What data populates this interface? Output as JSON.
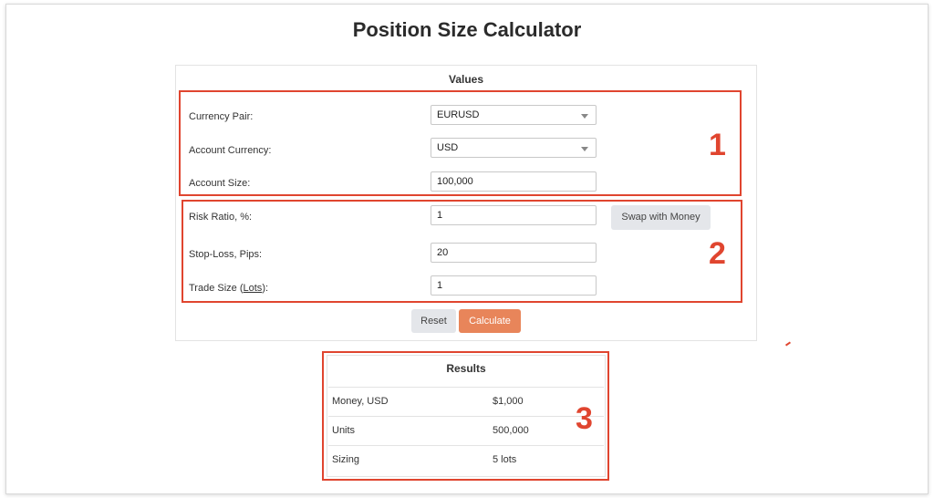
{
  "page": {
    "title": "Position Size Calculator"
  },
  "values": {
    "heading": "Values",
    "currency_pair": {
      "label": "Currency Pair:",
      "value": "EURUSD"
    },
    "account_currency": {
      "label": "Account Currency:",
      "value": "USD"
    },
    "account_size": {
      "label": "Account Size:",
      "value": "100,000"
    },
    "risk_ratio": {
      "label": "Risk Ratio, %:",
      "value": "1"
    },
    "stop_loss": {
      "label": "Stop-Loss, Pips:",
      "value": "20"
    },
    "trade_size": {
      "label_prefix": "Trade Size (",
      "label_link": "Lots",
      "label_suffix": "):",
      "value": "1"
    },
    "swap_button": "Swap with Money",
    "reset_button": "Reset",
    "calculate_button": "Calculate"
  },
  "results": {
    "heading": "Results",
    "rows": [
      {
        "label": "Money, USD",
        "value": "$1,000"
      },
      {
        "label": "Units",
        "value": "500,000"
      },
      {
        "label": "Sizing",
        "value": "5 lots"
      }
    ]
  },
  "annotations": {
    "one": "1",
    "two": "2",
    "three": "3"
  },
  "colors": {
    "accent": "#e8855a",
    "annotation": "#e0452f",
    "button_grey": "#e4e6ea"
  }
}
